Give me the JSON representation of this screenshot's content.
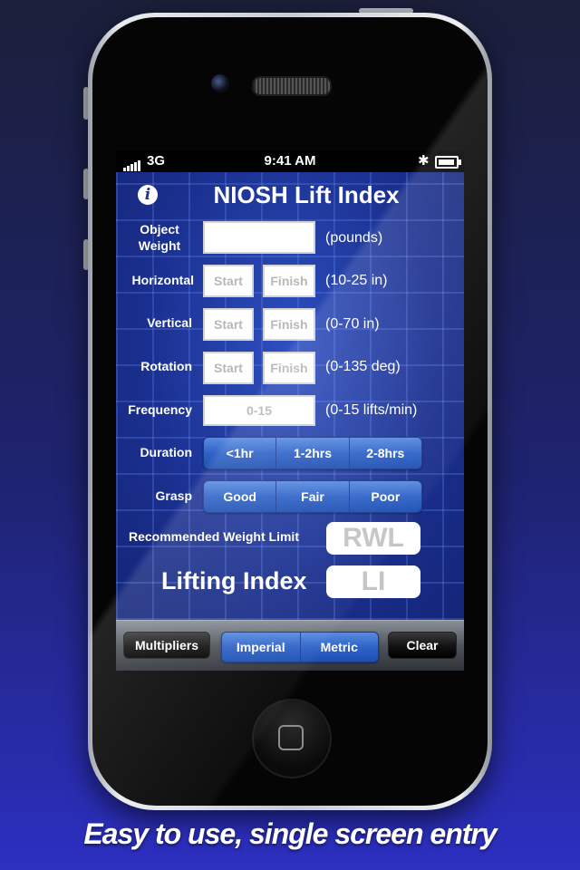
{
  "status": {
    "carrier": "3G",
    "time": "9:41 AM",
    "bluetooth_icon": "bluetooth-icon",
    "battery_icon": "battery-icon"
  },
  "app": {
    "title": "NIOSH Lift Index",
    "info_icon": "info-icon"
  },
  "form": {
    "object_weight": {
      "label": "Object\nWeight",
      "value": "",
      "unit": "(pounds)"
    },
    "horizontal": {
      "label": "Horizontal",
      "start_placeholder": "Start",
      "finish_placeholder": "Finish",
      "unit": "(10-25 in)"
    },
    "vertical": {
      "label": "Vertical",
      "start_placeholder": "Start",
      "finish_placeholder": "Finish",
      "unit": "(0-70 in)"
    },
    "rotation": {
      "label": "Rotation",
      "start_placeholder": "Start",
      "finish_placeholder": "Finish",
      "unit": "(0-135 deg)"
    },
    "frequency": {
      "label": "Frequency",
      "placeholder": "0-15",
      "unit": "(0-15 lifts/min)"
    },
    "duration": {
      "label": "Duration",
      "options": [
        "<1hr",
        "1-2hrs",
        "2-8hrs"
      ]
    },
    "grasp": {
      "label": "Grasp",
      "options": [
        "Good",
        "Fair",
        "Poor"
      ]
    }
  },
  "results": {
    "rwl_label": "Recommended Weight Limit",
    "rwl_value": "RWL",
    "li_label": "Lifting Index",
    "li_value": "LI"
  },
  "toolbar": {
    "multipliers": "Multipliers",
    "units": [
      "Imperial",
      "Metric"
    ],
    "clear": "Clear"
  },
  "caption": "Easy to use, single screen entry"
}
